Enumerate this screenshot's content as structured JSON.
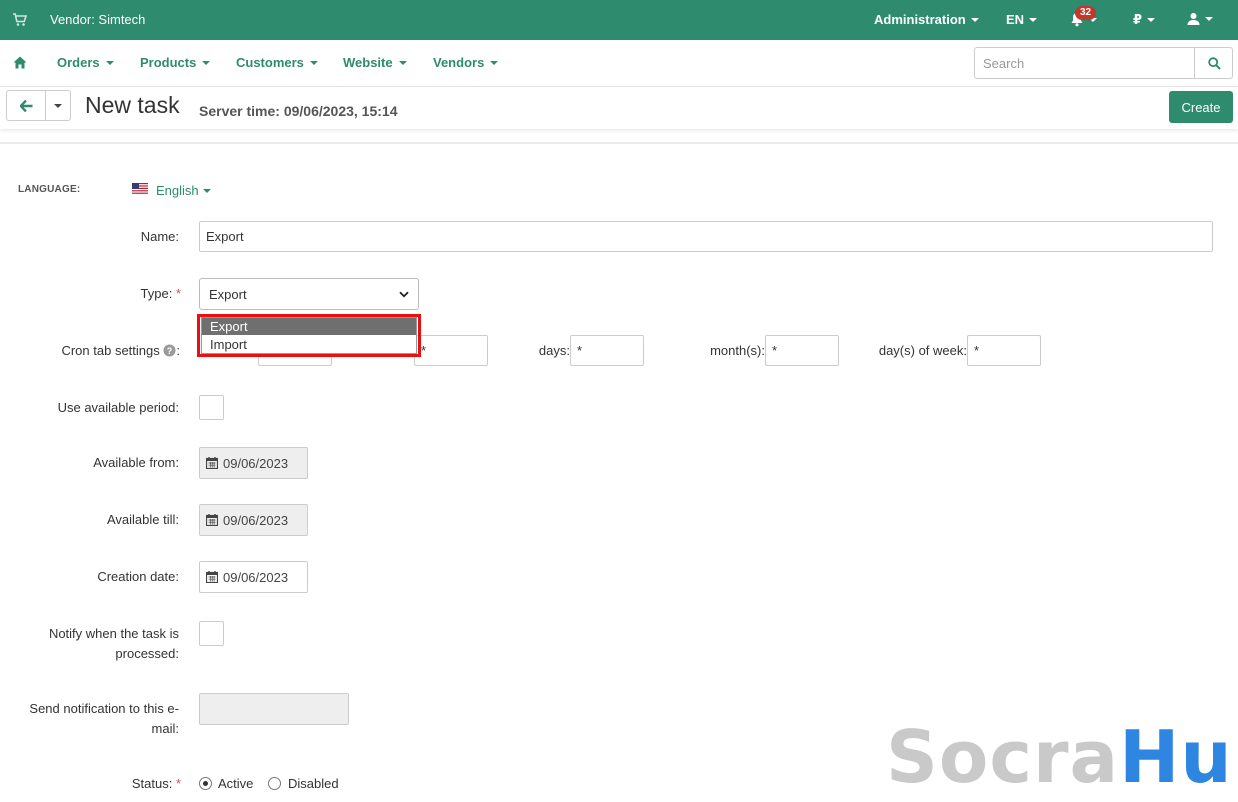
{
  "topbar": {
    "vendor_label": "Vendor: Simtech",
    "administration": "Administration",
    "language": "EN",
    "notifications_count": "32",
    "currency": "₽"
  },
  "nav": {
    "items": [
      "Orders",
      "Products",
      "Customers",
      "Website",
      "Vendors"
    ],
    "search_placeholder": "Search"
  },
  "page": {
    "title": "New task",
    "server_time": "Server time: 09/06/2023, 15:14",
    "create_label": "Create"
  },
  "form": {
    "language_label": "LANGUAGE:",
    "language_value": "English",
    "name_label": "Name:",
    "name_value": "Export",
    "type_label": "Type:",
    "type_value": "Export",
    "type_options": [
      "Export",
      "Import"
    ],
    "cron_label": "Cron tab settings",
    "cron_fields": {
      "hours_value": "*",
      "days_label": "days:",
      "days_value": "*",
      "months_label": "month(s):",
      "months_value": "*",
      "dow_label": "day(s) of week:",
      "dow_value": "*"
    },
    "use_period_label": "Use available period:",
    "available_from_label": "Available from:",
    "available_from_value": "09/06/2023",
    "available_till_label": "Available till:",
    "available_till_value": "09/06/2023",
    "creation_date_label": "Creation date:",
    "creation_date_value": "09/06/2023",
    "notify_label_1": "Notify when the task is",
    "notify_label_2": "processed:",
    "send_label_1": "Send notification to this e-",
    "send_label_2": "mail:",
    "status_label": "Status:",
    "status_options": [
      "Active",
      "Disabled"
    ]
  },
  "watermark": {
    "part1": "Socra",
    "part2": "Hub"
  },
  "colors": {
    "brand": "#2f8b6e",
    "required": "#d9534f",
    "highlight": "#e81010"
  }
}
